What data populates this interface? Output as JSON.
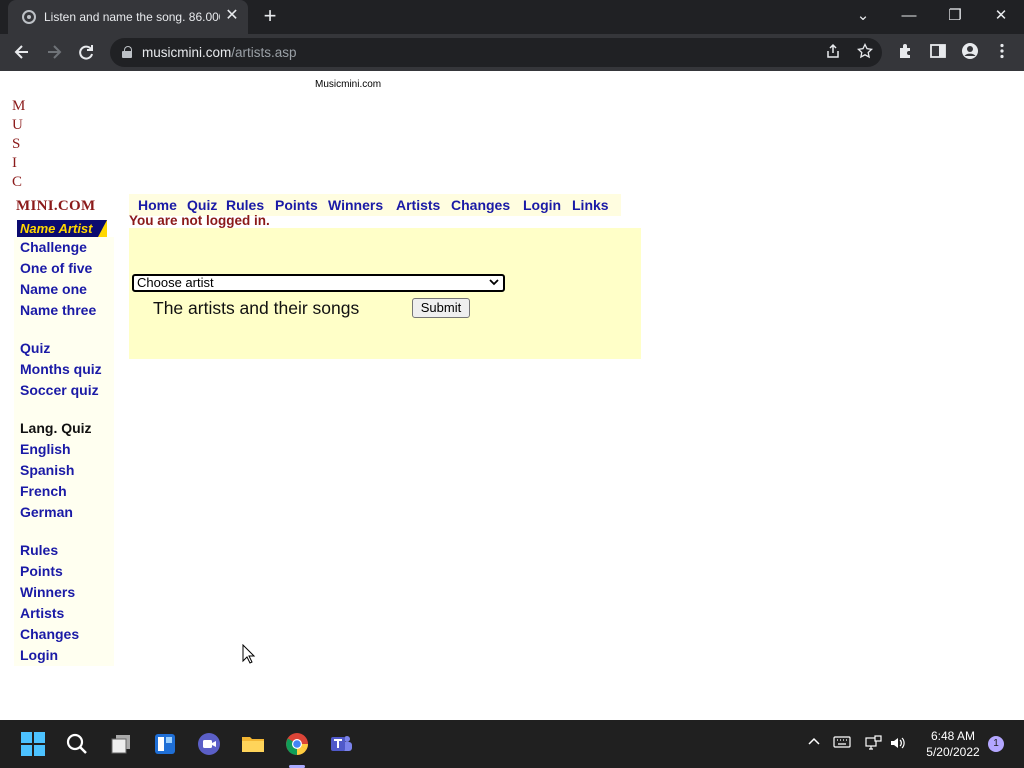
{
  "browser": {
    "tab_title": "Listen and name the song. 86.000",
    "tab_close": "✕",
    "new_tab": "+",
    "url_host": "musicmini.com",
    "url_path": "/artists.asp",
    "window_minimize": "—",
    "window_restore": "❐",
    "window_close": "✕",
    "tab_menu": "⌄"
  },
  "site": {
    "header_small": "Musicmini.com",
    "logo_letters": [
      "M",
      "U",
      "S",
      "I",
      "C"
    ],
    "logo_mini": "MINI.COM",
    "name_artist_badge": "Name Artist"
  },
  "side_nav": {
    "group1": [
      "Challenge",
      "One of five",
      "Name one",
      "Name three"
    ],
    "group2": [
      "Quiz",
      "Months quiz",
      "Soccer quiz"
    ],
    "lang_label": "Lang. Quiz",
    "group3": [
      "English",
      "Spanish",
      "French",
      "German"
    ],
    "group4": [
      "Rules",
      "Points",
      "Winners",
      "Artists",
      "Changes",
      "Login"
    ]
  },
  "top_nav": [
    "Home",
    "Quiz",
    "Rules",
    "Points",
    "Winners",
    "Artists",
    "Changes",
    "Login",
    "Links"
  ],
  "main": {
    "login_status": "You are not logged in.",
    "select_value": "Choose artist",
    "panel_text": "The artists and their songs",
    "submit_label": "Submit"
  },
  "taskbar": {
    "time": "6:48 AM",
    "date": "5/20/2022",
    "notification_count": "1"
  },
  "colors": {
    "link_blue": "#1a1aa6",
    "maroon": "#8b1a1a",
    "panel_yellow": "#ffffc8",
    "badge_navy": "#0b0b6f",
    "badge_gold": "#ffd700"
  }
}
